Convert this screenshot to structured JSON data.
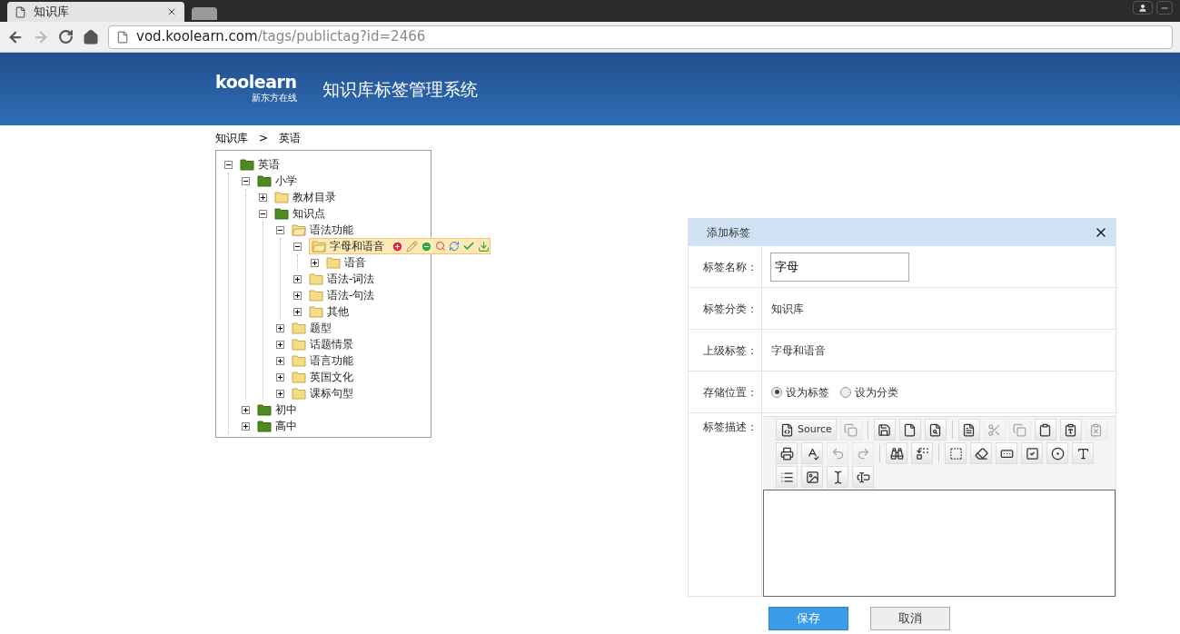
{
  "browser": {
    "tab_title": "知识库",
    "url_host": "vod.koolearn.com",
    "url_path": "/tags/publictag?id=2466"
  },
  "header": {
    "logo": "koolearn",
    "logo_subtitle": "新东方在线",
    "title": "知识库标签管理系统"
  },
  "breadcrumb": [
    {
      "label": "知识库"
    },
    {
      "label": ">"
    },
    {
      "label": "英语"
    }
  ],
  "tree": [
    {
      "label": "英语",
      "kind": "category",
      "expanded": true,
      "selected": false,
      "children": [
        {
          "label": "小学",
          "kind": "category",
          "expanded": true,
          "selected": false,
          "children": [
            {
              "label": "教材目录",
              "kind": "folder",
              "expanded": false,
              "selected": false
            },
            {
              "label": "知识点",
              "kind": "category",
              "expanded": true,
              "selected": false,
              "children": [
                {
                  "label": "语法功能",
                  "kind": "folder",
                  "expanded": true,
                  "selected": false,
                  "children": [
                    {
                      "label": "字母和语音",
                      "kind": "folder",
                      "expanded": true,
                      "selected": true,
                      "children": [
                        {
                          "label": "语音",
                          "kind": "folder",
                          "expanded": false,
                          "selected": false
                        }
                      ]
                    },
                    {
                      "label": "语法-词法",
                      "kind": "folder",
                      "expanded": false,
                      "selected": false
                    },
                    {
                      "label": "语法-句法",
                      "kind": "folder",
                      "expanded": false,
                      "selected": false
                    },
                    {
                      "label": "其他",
                      "kind": "folder",
                      "expanded": false,
                      "selected": false
                    }
                  ]
                },
                {
                  "label": "题型",
                  "kind": "folder",
                  "expanded": false,
                  "selected": false
                },
                {
                  "label": "话题情景",
                  "kind": "folder",
                  "expanded": false,
                  "selected": false
                },
                {
                  "label": "语言功能",
                  "kind": "folder",
                  "expanded": false,
                  "selected": false
                },
                {
                  "label": "英国文化",
                  "kind": "folder",
                  "expanded": false,
                  "selected": false
                },
                {
                  "label": "课标句型",
                  "kind": "folder",
                  "expanded": false,
                  "selected": false
                }
              ]
            }
          ]
        },
        {
          "label": "初中",
          "kind": "category",
          "expanded": false,
          "selected": false
        },
        {
          "label": "高中",
          "kind": "category",
          "expanded": false,
          "selected": false
        }
      ]
    }
  ],
  "dialog": {
    "title": "添加标签",
    "name_field": {
      "label": "标签名称：",
      "value": "字母"
    },
    "category": {
      "label": "标签分类：",
      "value": "知识库"
    },
    "parent": {
      "label": "上级标签：",
      "value": "字母和语音"
    },
    "storage": {
      "label": "存储位置：",
      "options": [
        {
          "label": "设为标签",
          "selected": true
        },
        {
          "label": "设为分类",
          "selected": false
        }
      ]
    },
    "description": {
      "label": "标签描述：",
      "toolbar_rows": [
        [
          {
            "kind": "source",
            "label": "Source",
            "disabled": false
          },
          {
            "kind": "templates",
            "disabled": true
          },
          {
            "kind": "sep"
          },
          {
            "kind": "save",
            "disabled": false
          },
          {
            "kind": "newpage",
            "disabled": false
          },
          {
            "kind": "preview",
            "disabled": false
          },
          {
            "kind": "sep"
          },
          {
            "kind": "document",
            "disabled": false
          },
          {
            "kind": "cut",
            "disabled": true
          },
          {
            "kind": "copy",
            "disabled": true
          },
          {
            "kind": "paste",
            "disabled": false
          },
          {
            "kind": "pastetext",
            "disabled": false
          },
          {
            "kind": "pasteword",
            "disabled": true
          }
        ],
        [
          {
            "kind": "print",
            "disabled": false
          },
          {
            "kind": "spellcheck",
            "disabled": false
          },
          {
            "kind": "undo",
            "disabled": true
          },
          {
            "kind": "redo",
            "disabled": true
          },
          {
            "kind": "sep"
          },
          {
            "kind": "find",
            "disabled": false
          },
          {
            "kind": "replace",
            "disabled": false
          },
          {
            "kind": "sep"
          },
          {
            "kind": "selectall",
            "disabled": false
          },
          {
            "kind": "eraser",
            "disabled": false
          },
          {
            "kind": "form",
            "disabled": false
          },
          {
            "kind": "checkbox",
            "disabled": false
          },
          {
            "kind": "radio",
            "disabled": false
          },
          {
            "kind": "textarea",
            "disabled": false
          }
        ],
        [
          {
            "kind": "select",
            "disabled": false
          },
          {
            "kind": "image",
            "disabled": false
          },
          {
            "kind": "hiddenfield",
            "disabled": false
          },
          {
            "kind": "textfield",
            "disabled": false
          }
        ]
      ]
    },
    "buttons": [
      {
        "label": "保存",
        "kind": "primary"
      },
      {
        "label": "取消",
        "kind": "secondary"
      }
    ]
  }
}
